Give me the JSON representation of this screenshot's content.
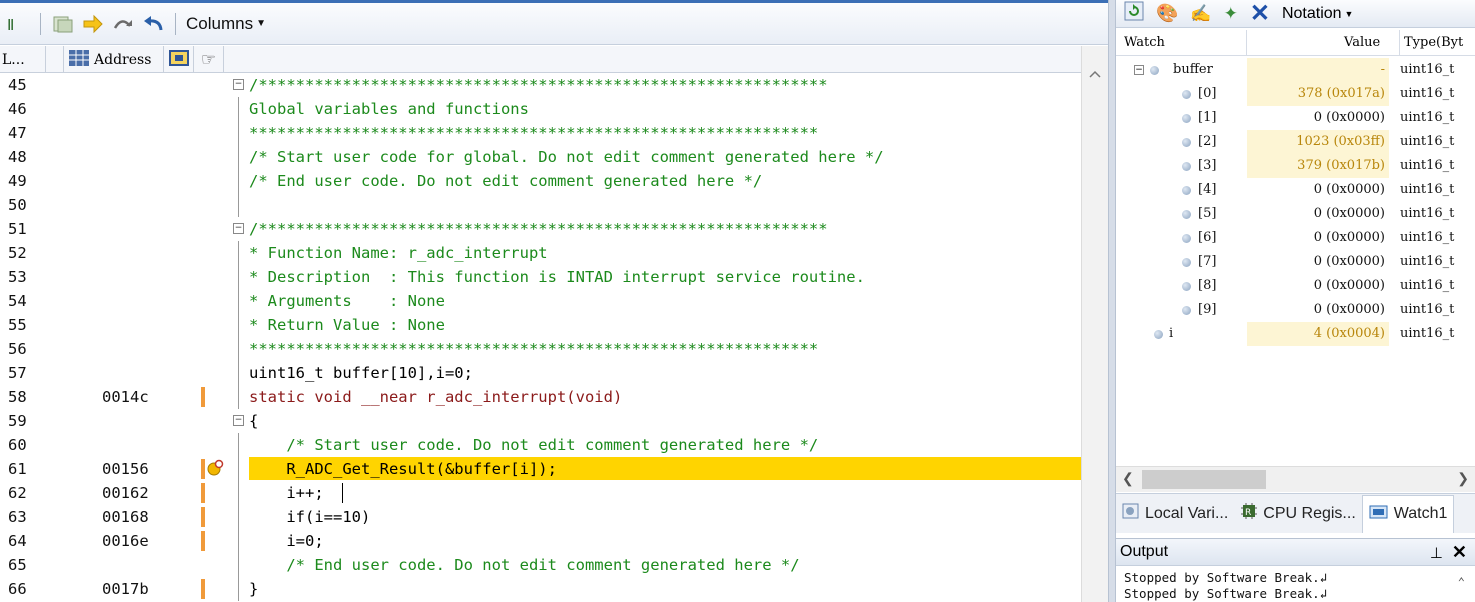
{
  "toolbar": {
    "columns_label": "Columns",
    "icons": [
      "source-icon",
      "disassembly-icon",
      "show-current-pc-icon",
      "step-over-icon",
      "undo-icon"
    ]
  },
  "columns": {
    "line_header": "L...",
    "address_header": "Address"
  },
  "code": {
    "lines": [
      {
        "n": "45",
        "addr": "",
        "text": "/*************************************************************",
        "cls": "c",
        "fold": "minus"
      },
      {
        "n": "46",
        "addr": "",
        "text": "Global variables and functions",
        "cls": "c"
      },
      {
        "n": "47",
        "addr": "",
        "text": "*************************************************************",
        "cls": "c"
      },
      {
        "n": "48",
        "addr": "",
        "text": "/* Start user code for global. Do not edit comment generated here */",
        "cls": "c"
      },
      {
        "n": "49",
        "addr": "",
        "text": "/* End user code. Do not edit comment generated here */",
        "cls": "c"
      },
      {
        "n": "50",
        "addr": "",
        "text": "",
        "cls": ""
      },
      {
        "n": "51",
        "addr": "",
        "text": "/*************************************************************",
        "cls": "c",
        "fold": "minus"
      },
      {
        "n": "52",
        "addr": "",
        "text": "* Function Name: r_adc_interrupt",
        "cls": "c"
      },
      {
        "n": "53",
        "addr": "",
        "text": "* Description  : This function is INTAD interrupt service routine.",
        "cls": "c"
      },
      {
        "n": "54",
        "addr": "",
        "text": "* Arguments    : None",
        "cls": "c"
      },
      {
        "n": "55",
        "addr": "",
        "text": "* Return Value : None",
        "cls": "c"
      },
      {
        "n": "56",
        "addr": "",
        "text": "*************************************************************",
        "cls": "c"
      },
      {
        "n": "57",
        "addr": "",
        "text": "uint16_t buffer[10],i=0;",
        "cls": ""
      },
      {
        "n": "58",
        "addr": "0014c",
        "text": "static void __near r_adc_interrupt(void)",
        "cls": "kwline",
        "bp": true
      },
      {
        "n": "59",
        "addr": "",
        "text": "{",
        "cls": "",
        "fold": "minus"
      },
      {
        "n": "60",
        "addr": "",
        "text": "    /* Start user code. Do not edit comment generated here */",
        "cls": "c"
      },
      {
        "n": "61",
        "addr": "00156",
        "text": "    R_ADC_Get_Result(&buffer[i]);",
        "cls": "",
        "hl": true,
        "bp": true,
        "pc": true
      },
      {
        "n": "62",
        "addr": "00162",
        "text": "    i++;",
        "cls": "",
        "bp": true,
        "cursor": true
      },
      {
        "n": "63",
        "addr": "00168",
        "text": "    if(i==10)",
        "cls": "",
        "bp": true
      },
      {
        "n": "64",
        "addr": "0016e",
        "text": "    i=0;",
        "cls": "",
        "bp": true
      },
      {
        "n": "65",
        "addr": "",
        "text": "    /* End user code. Do not edit comment generated here */",
        "cls": "c"
      },
      {
        "n": "66",
        "addr": "0017b",
        "text": "}",
        "cls": "",
        "bp": true
      }
    ]
  },
  "watch": {
    "toolbar_notation": "Notation",
    "headers": {
      "name": "Watch",
      "value": "Value",
      "type": "Type(Byt"
    },
    "rows": [
      {
        "name": "buffer",
        "value": "-",
        "type": "uint16_t",
        "level": 0,
        "expander": "minus",
        "hot": true
      },
      {
        "name": "[0]",
        "value": "378 (0x017a)",
        "type": "uint16_t",
        "level": 1,
        "hot": true
      },
      {
        "name": "[1]",
        "value": "0 (0x0000)",
        "type": "uint16_t",
        "level": 1,
        "hot": false
      },
      {
        "name": "[2]",
        "value": "1023 (0x03ff)",
        "type": "uint16_t",
        "level": 1,
        "hot": true
      },
      {
        "name": "[3]",
        "value": "379 (0x017b)",
        "type": "uint16_t",
        "level": 1,
        "hot": true
      },
      {
        "name": "[4]",
        "value": "0 (0x0000)",
        "type": "uint16_t",
        "level": 1,
        "hot": false
      },
      {
        "name": "[5]",
        "value": "0 (0x0000)",
        "type": "uint16_t",
        "level": 1,
        "hot": false
      },
      {
        "name": "[6]",
        "value": "0 (0x0000)",
        "type": "uint16_t",
        "level": 1,
        "hot": false
      },
      {
        "name": "[7]",
        "value": "0 (0x0000)",
        "type": "uint16_t",
        "level": 1,
        "hot": false
      },
      {
        "name": "[8]",
        "value": "0 (0x0000)",
        "type": "uint16_t",
        "level": 1,
        "hot": false
      },
      {
        "name": "[9]",
        "value": "0 (0x0000)",
        "type": "uint16_t",
        "level": 1,
        "hot": false
      },
      {
        "name": "i",
        "value": "4 (0x0004)",
        "type": "uint16_t",
        "level": 0,
        "hot": true
      }
    ]
  },
  "tabs": [
    {
      "label": "Local Vari...",
      "icon": "local-variables-icon",
      "active": false
    },
    {
      "label": "CPU Regis...",
      "icon": "cpu-registers-icon",
      "active": false
    },
    {
      "label": "Watch1",
      "icon": "watch-icon",
      "active": true
    }
  ],
  "output": {
    "title": "Output",
    "pin_glyph": "$",
    "lines": [
      "Stopped by Software Break.↲",
      "Stopped by Software Break.↲"
    ]
  },
  "colors": {
    "highlight": "#ffd400",
    "comment": "#1c8a1c",
    "keyword": "#8b1a1a",
    "breakpoint_bar": "#f09a3a"
  }
}
